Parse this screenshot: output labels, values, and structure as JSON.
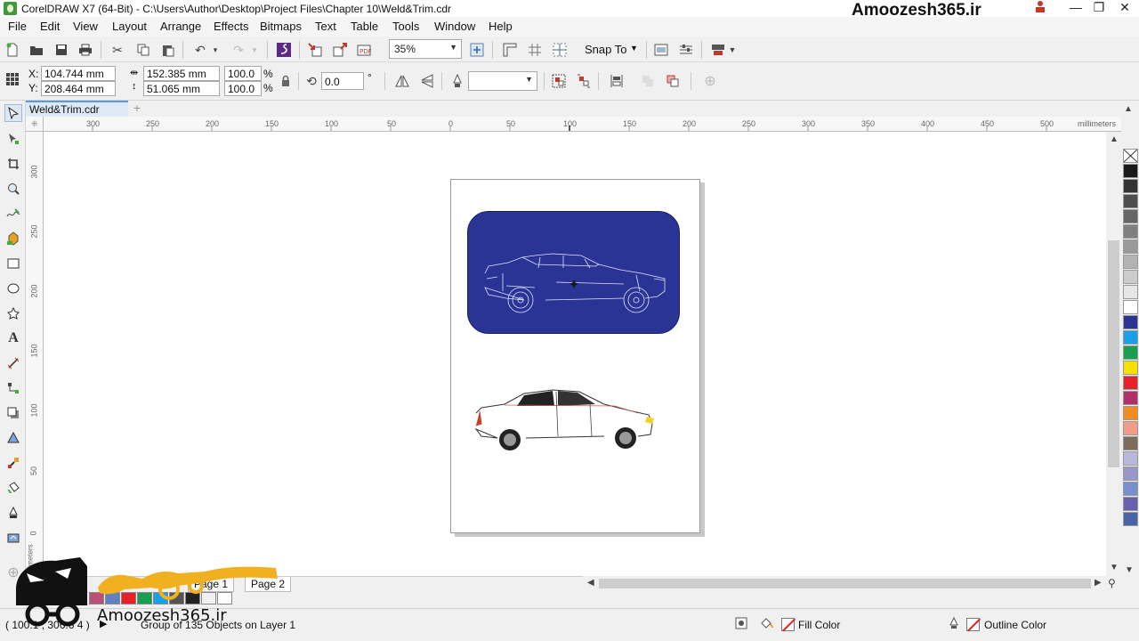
{
  "window": {
    "title": "CorelDRAW X7 (64-Bit) - C:\\Users\\Author\\Desktop\\Project Files\\Chapter 10\\Weld&Trim.cdr",
    "brand": "Amoozesh365.ir"
  },
  "menu": [
    "File",
    "Edit",
    "View",
    "Layout",
    "Arrange",
    "Effects",
    "Bitmaps",
    "Text",
    "Table",
    "Tools",
    "Window",
    "Help"
  ],
  "toolbar": {
    "zoom_level": "35%",
    "snap_to_label": "Snap To"
  },
  "property_bar": {
    "x_label": "X:",
    "x_value": "104.744 mm",
    "y_label": "Y:",
    "y_value": "208.464 mm",
    "width_value": "152.385 mm",
    "height_value": "51.065 mm",
    "scale_w": "100.0",
    "scale_h": "100.0",
    "percent": "%",
    "rotation": "0.0",
    "degree": "°"
  },
  "document_tab": {
    "name": "Weld&Trim.cdr",
    "add": "+"
  },
  "ruler": {
    "top_ticks": [
      "300",
      "250",
      "200",
      "150",
      "100",
      "50",
      "0",
      "50",
      "100",
      "150",
      "200",
      "250",
      "300",
      "350",
      "400",
      "450",
      "500"
    ],
    "units": "millimeters",
    "left_ticks": [
      "300",
      "250",
      "200",
      "150",
      "100",
      "50",
      "0"
    ],
    "left_units": "millimeters"
  },
  "page_nav": {
    "pages": [
      "Page 1",
      "Page 2"
    ]
  },
  "palette_colors": [
    "#1a1a1a",
    "#333333",
    "#4d4d4d",
    "#666666",
    "#808080",
    "#999999",
    "#b3b3b3",
    "#cccccc",
    "#e6e6e6",
    "#ffffff",
    "#2a3494",
    "#1aa0e8",
    "#16a050",
    "#f5e000",
    "#e8202a",
    "#b0306a",
    "#f08c20",
    "#f29c88",
    "#7d6e5c",
    "#b8b8d8",
    "#9898c8",
    "#7890d0",
    "#6a60b0",
    "#4a64a8"
  ],
  "doc_palette_colors": [
    "#b8507a",
    "#6080c0",
    "#e8202a",
    "#16a050",
    "#1aa0e8",
    "#555555",
    "#222222",
    "#f0f0f0",
    "#ffffff"
  ],
  "status": {
    "cursor_coords": "( 100.1 , 306.6 4 )",
    "selection_info": "Group of 135 Objects on Layer 1",
    "fill_label": "Fill Color",
    "outline_label": "Outline Color"
  },
  "watermark": {
    "text": "Amoozesh365.ir"
  }
}
